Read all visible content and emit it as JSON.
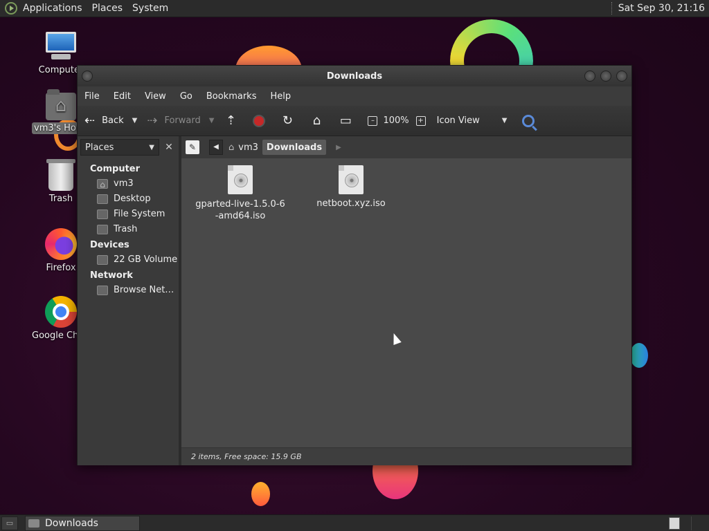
{
  "top_panel": {
    "menus": [
      "Applications",
      "Places",
      "System"
    ],
    "clock": "Sat Sep 30, 21:16"
  },
  "desktop": {
    "icons": [
      {
        "label": "Computer",
        "icon": "computer-icon"
      },
      {
        "label": "vm3's Home",
        "icon": "home-folder-icon"
      },
      {
        "label": "Trash",
        "icon": "trash-icon"
      },
      {
        "label": "Firefox",
        "icon": "firefox-icon"
      },
      {
        "label": "Google Chrome",
        "icon": "chrome-icon"
      }
    ]
  },
  "window": {
    "title": "Downloads",
    "menus": [
      "File",
      "Edit",
      "View",
      "Go",
      "Bookmarks",
      "Help"
    ],
    "toolbar": {
      "back_label": "Back",
      "forward_label": "Forward",
      "zoom": "100%",
      "view_mode": "Icon View"
    },
    "sidebar": {
      "selector": "Places",
      "sections": [
        {
          "title": "Computer",
          "items": [
            "vm3",
            "Desktop",
            "File System",
            "Trash"
          ]
        },
        {
          "title": "Devices",
          "items": [
            "22 GB Volume"
          ]
        },
        {
          "title": "Network",
          "items": [
            "Browse Net…"
          ]
        }
      ]
    },
    "pathbar": {
      "crumbs": [
        "vm3",
        "Downloads"
      ]
    },
    "files": [
      {
        "name": "gparted-live-1.5.0-6-amd64.iso",
        "icon": "disc-image-icon"
      },
      {
        "name": "netboot.xyz.iso",
        "icon": "disc-image-icon"
      }
    ],
    "status": "2 items, Free space: 15.9 GB"
  },
  "taskbar": {
    "tasks": [
      "Downloads"
    ]
  },
  "colors": {
    "panel": "#2b2b2b",
    "window_bg": "#3a3a3a",
    "content_bg": "#494949",
    "accent_stop": "#c62828"
  }
}
